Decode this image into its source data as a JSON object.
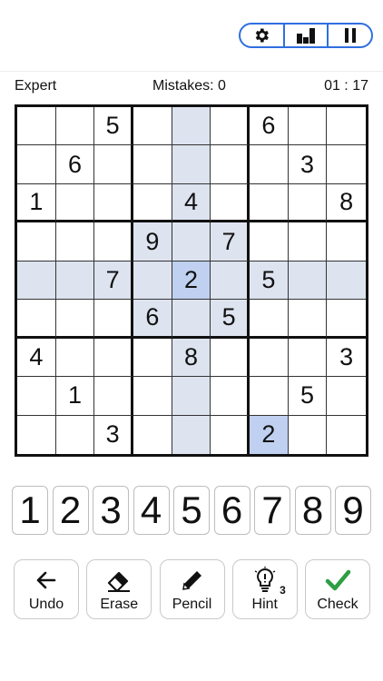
{
  "header": {
    "icons": {
      "settings": "gear-icon",
      "stats": "bar-chart-icon",
      "pause": "pause-icon"
    },
    "accent_color": "#2f6fe0"
  },
  "status": {
    "difficulty": "Expert",
    "mistakes": "Mistakes: 0",
    "timer": "01 : 17"
  },
  "board": {
    "grid": [
      [
        "",
        "",
        "5",
        "",
        "",
        "",
        "6",
        "",
        ""
      ],
      [
        "",
        "6",
        "",
        "",
        "",
        "",
        "",
        "3",
        ""
      ],
      [
        "1",
        "",
        "",
        "",
        "4",
        "",
        "",
        "",
        "8"
      ],
      [
        "",
        "",
        "",
        "9",
        "",
        "7",
        "",
        "",
        ""
      ],
      [
        "",
        "",
        "7",
        "",
        "2",
        "",
        "5",
        "",
        ""
      ],
      [
        "",
        "",
        "",
        "6",
        "",
        "5",
        "",
        "",
        ""
      ],
      [
        "4",
        "",
        "",
        "",
        "8",
        "",
        "",
        "",
        "3"
      ],
      [
        "",
        "1",
        "",
        "",
        "",
        "",
        "",
        "5",
        ""
      ],
      [
        "",
        "",
        "3",
        "",
        "",
        "",
        "2",
        "",
        ""
      ]
    ],
    "selected": {
      "row": 4,
      "col": 4,
      "value": "2"
    },
    "highlight_color": "#dde3ef",
    "same_value_color": "#bfd0f0"
  },
  "numpad": [
    "1",
    "2",
    "3",
    "4",
    "5",
    "6",
    "7",
    "8",
    "9"
  ],
  "actions": [
    {
      "label": "Undo",
      "icon": "arrow-left-icon"
    },
    {
      "label": "Erase",
      "icon": "eraser-icon"
    },
    {
      "label": "Pencil",
      "icon": "pencil-icon"
    },
    {
      "label": "Hint",
      "icon": "lightbulb-icon",
      "count": "3"
    },
    {
      "label": "Check",
      "icon": "checkmark-icon",
      "color": "#2e9e44"
    }
  ]
}
